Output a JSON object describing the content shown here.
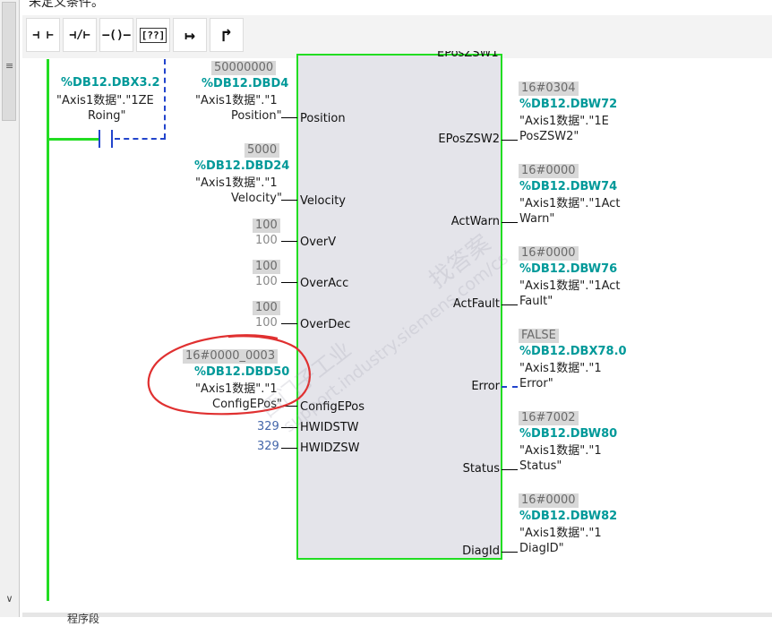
{
  "header": {
    "partial_text": "未定义条件。"
  },
  "toolbar": {
    "buttons": [
      {
        "name": "no-contact-icon",
        "glyph": "⊣ ⊢"
      },
      {
        "name": "nc-contact-icon",
        "glyph": "⊣/⊢"
      },
      {
        "name": "coil-icon",
        "glyph": "–()–"
      },
      {
        "name": "empty-box-icon",
        "glyph": "[??]"
      },
      {
        "name": "branch-open-icon",
        "glyph": "↦"
      },
      {
        "name": "branch-close-icon",
        "glyph": "↱"
      }
    ]
  },
  "contact": {
    "address": "%DB12.DBX3.2",
    "symbol_line1": "\"Axis1数据\".\"1ZE",
    "symbol_line2": "Roing\""
  },
  "block": {
    "top_label_partial": "EPosZSW1",
    "inputs": [
      {
        "pin": "Position",
        "value": "50000000",
        "address": "%DB12.DBD4",
        "symbol_line1": "\"Axis1数据\".\"1",
        "symbol_line2": "Position\""
      },
      {
        "pin": "Velocity",
        "value": "5000",
        "address": "%DB12.DBD24",
        "symbol_line1": "\"Axis1数据\".\"1",
        "symbol_line2": "Velocity\""
      },
      {
        "pin": "OverV",
        "value": "100",
        "constant": "100"
      },
      {
        "pin": "OverAcc",
        "value": "100",
        "constant": "100"
      },
      {
        "pin": "OverDec",
        "value": "100",
        "constant": "100"
      },
      {
        "pin": "ConfigEPos",
        "value": "16#0000_0003",
        "address": "%DB12.DBD50",
        "symbol_line1": "\"Axis1数据\".\"1",
        "symbol_line2": "ConfigEPos\""
      },
      {
        "pin": "HWIDSTW",
        "constant": "329"
      },
      {
        "pin": "HWIDZSW",
        "constant": "329"
      }
    ],
    "outputs": [
      {
        "pin": "EPosZSW2",
        "value": "16#0304",
        "address": "%DB12.DBW72",
        "symbol_line1": "\"Axis1数据\".\"1E",
        "symbol_line2": "PosZSW2\""
      },
      {
        "pin": "ActWarn",
        "value": "16#0000",
        "address": "%DB12.DBW74",
        "symbol_line1": "\"Axis1数据\".\"1Act",
        "symbol_line2": "Warn\""
      },
      {
        "pin": "ActFault",
        "value": "16#0000",
        "address": "%DB12.DBW76",
        "symbol_line1": "\"Axis1数据\".\"1Act",
        "symbol_line2": "Fault\""
      },
      {
        "pin": "Error",
        "value": "FALSE",
        "address": "%DB12.DBX78.0",
        "symbol_line1": "\"Axis1数据\".\"1",
        "symbol_line2": "Error\""
      },
      {
        "pin": "Status",
        "value": "16#7002",
        "address": "%DB12.DBW80",
        "symbol_line1": "\"Axis1数据\".\"1",
        "symbol_line2": "Status\""
      },
      {
        "pin": "DiagId",
        "value": "16#0000",
        "address": "%DB12.DBW82",
        "symbol_line1": "\"Axis1数据\".\"1",
        "symbol_line2": "DiagID\""
      }
    ]
  },
  "watermark": {
    "text1": "找答案",
    "text2": "西门子工业",
    "url": "support.industry.siemens.com/cs"
  },
  "footer": {
    "partial_text": "程序段"
  },
  "colors": {
    "rail": "#22dd22",
    "address": "#009999",
    "annotation": "#e03030",
    "block_bg": "#e4e4ea"
  }
}
